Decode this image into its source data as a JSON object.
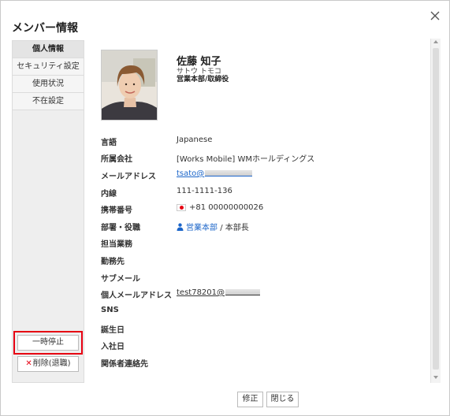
{
  "dialog": {
    "title": "メンバー情報"
  },
  "sidebar": {
    "items": [
      {
        "label": "個人情報",
        "active": true
      },
      {
        "label": "セキュリティ設定",
        "active": false
      },
      {
        "label": "使用状況",
        "active": false
      },
      {
        "label": "不在設定",
        "active": false
      }
    ],
    "suspend_label": "一時停止",
    "delete_label": "削除(退職)"
  },
  "profile": {
    "name": "佐藤 知子",
    "kana": "サトウ トモコ",
    "dept_title": "営業本部/取締役"
  },
  "fields": {
    "language": {
      "label": "言語",
      "value": "Japanese"
    },
    "company": {
      "label": "所属会社",
      "value": "[Works Mobile] WMホールディングス"
    },
    "email": {
      "label": "メールアドレス",
      "value": "tsato@"
    },
    "extension": {
      "label": "内線",
      "value": "111-1111-136"
    },
    "mobile": {
      "label": "携帯番号",
      "value": "+81 00000000026"
    },
    "dept": {
      "label": "部署・役職",
      "dept_value": "営業本部",
      "separator": "/",
      "position_value": "本部長"
    },
    "duty": {
      "label": "担当業務"
    },
    "workplace": {
      "label": "勤務先"
    },
    "submail": {
      "label": "サブメール"
    },
    "personal_email": {
      "label": "個人メールアドレス",
      "value": "test78201@"
    },
    "sns": {
      "label": "SNS"
    },
    "birthday": {
      "label": "誕生日"
    },
    "join_date": {
      "label": "入社日"
    },
    "emergency": {
      "label": "関係者連絡先"
    }
  },
  "footer": {
    "edit_label": "修正",
    "close_label": "閉じる"
  },
  "colors": {
    "accent_link": "#1b65c9",
    "highlight": "#e60012"
  }
}
